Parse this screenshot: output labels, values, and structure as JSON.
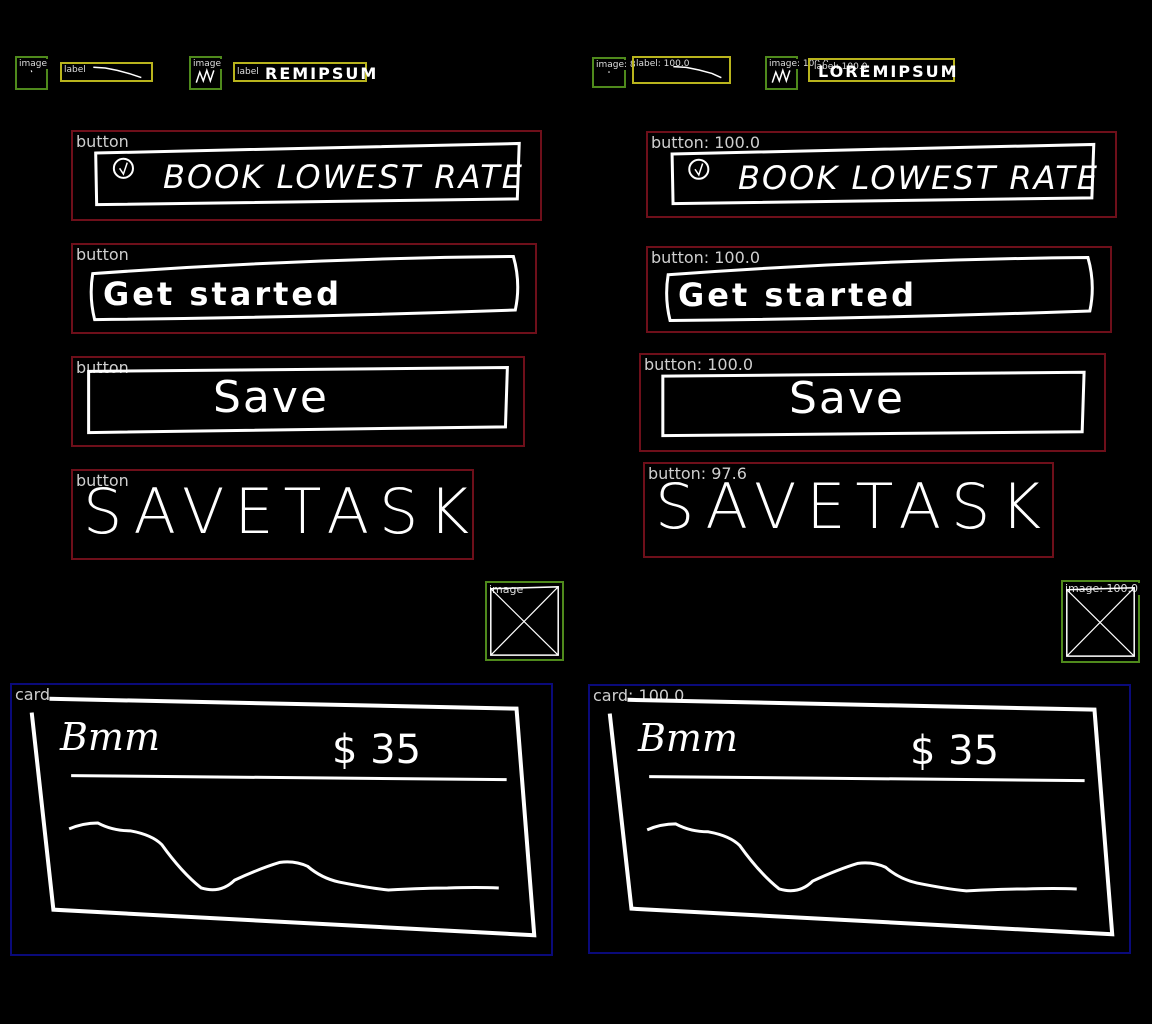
{
  "panels": [
    {
      "id": "annotation",
      "elements": {
        "image_1": {
          "tag": "image"
        },
        "label_1": {
          "tag": "label"
        },
        "image_2": {
          "tag": "image"
        },
        "label_2": {
          "tag": "label",
          "text": "REMIPSUM"
        },
        "button_book": {
          "tag": "button",
          "text": "BOOK LOWEST RATE"
        },
        "button_get": {
          "tag": "button",
          "text": "Get started"
        },
        "button_save": {
          "tag": "button",
          "text": "Save"
        },
        "button_task": {
          "tag": "button",
          "text": "SAVETASK"
        },
        "image_3": {
          "tag": "image"
        },
        "card": {
          "tag": "card",
          "title": "Bmm",
          "price": "$ 35"
        }
      }
    },
    {
      "id": "prediction",
      "elements": {
        "image_1": {
          "tag": "image: 81.9"
        },
        "label_1": {
          "tag": "label: 100.0"
        },
        "image_2": {
          "tag": "image: 100.0"
        },
        "label_2": {
          "tag": "label: 100.0",
          "text": "LOREMIPSUM"
        },
        "button_book": {
          "tag": "button: 100.0",
          "text": "BOOK LOWEST RATE"
        },
        "button_get": {
          "tag": "button: 100.0",
          "text": "Get started"
        },
        "button_save": {
          "tag": "button: 100.0",
          "text": "Save"
        },
        "button_task": {
          "tag": "button: 97.6",
          "text": "SAVETASK"
        },
        "image_3": {
          "tag": "image: 100.0"
        },
        "card": {
          "tag": "card: 100.0",
          "title": "Bmm",
          "price": "$ 35"
        }
      }
    }
  ],
  "colors": {
    "button_box": "#6e0f1a",
    "image_box": "#4f8a1c",
    "label_box": "#b9b41d",
    "card_box": "#0a0a7a",
    "sketch": "#ffffff",
    "background": "#000000"
  }
}
